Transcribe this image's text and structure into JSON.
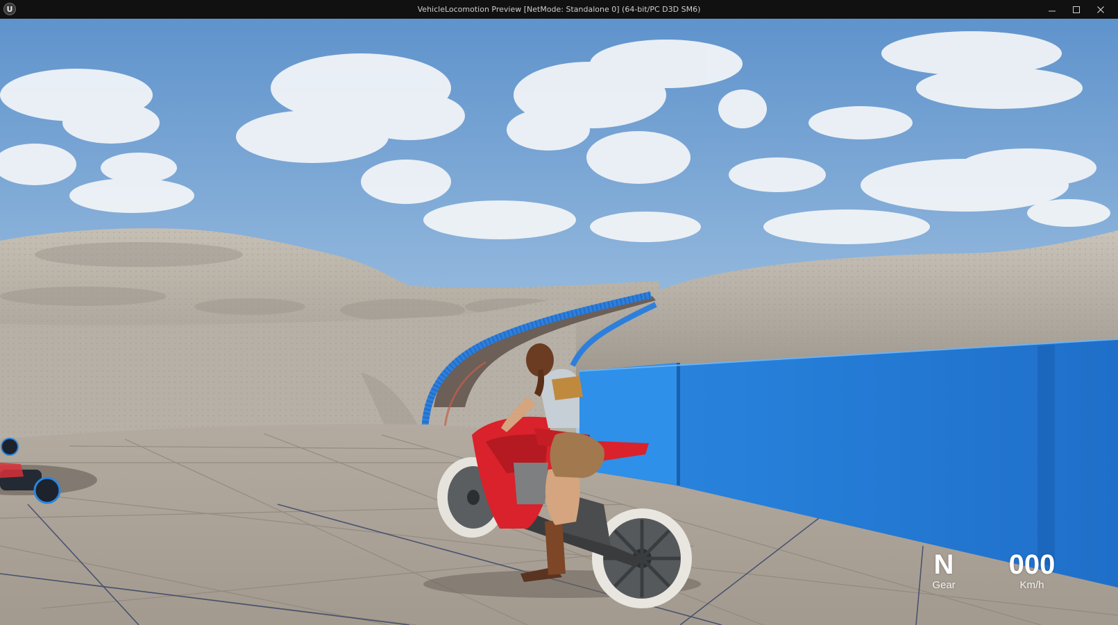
{
  "window": {
    "title": "VehicleLocomotion Preview [NetMode: Standalone 0]  (64-bit/PC D3D SM6)",
    "logo_icon": "unreal-engine-logo-icon",
    "controls": [
      "minimize-icon",
      "maximize-icon",
      "close-icon"
    ]
  },
  "hud": {
    "gear_value": "N",
    "gear_label": "Gear",
    "speed_value": "000",
    "speed_label": "Km/h"
  },
  "colors": {
    "sky_top": "#5f93cc",
    "sky_bottom": "#c6d9ea",
    "sand": "#b7b1a7",
    "floor": "#a89e93",
    "barrier_blue": "#2a86e0",
    "bike_red": "#d9222b"
  }
}
